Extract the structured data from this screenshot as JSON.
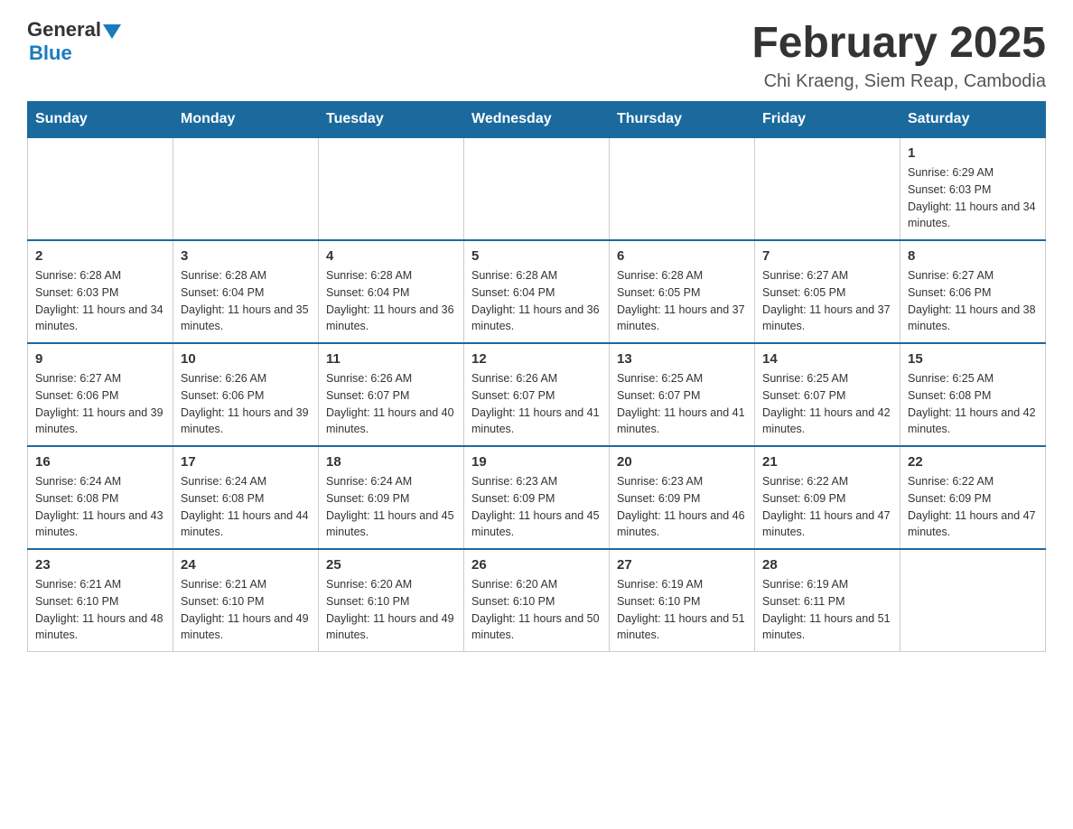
{
  "logo": {
    "general": "General",
    "blue": "Blue"
  },
  "title": "February 2025",
  "subtitle": "Chi Kraeng, Siem Reap, Cambodia",
  "days_of_week": [
    "Sunday",
    "Monday",
    "Tuesday",
    "Wednesday",
    "Thursday",
    "Friday",
    "Saturday"
  ],
  "weeks": [
    [
      {
        "day": "",
        "info": ""
      },
      {
        "day": "",
        "info": ""
      },
      {
        "day": "",
        "info": ""
      },
      {
        "day": "",
        "info": ""
      },
      {
        "day": "",
        "info": ""
      },
      {
        "day": "",
        "info": ""
      },
      {
        "day": "1",
        "info": "Sunrise: 6:29 AM\nSunset: 6:03 PM\nDaylight: 11 hours and 34 minutes."
      }
    ],
    [
      {
        "day": "2",
        "info": "Sunrise: 6:28 AM\nSunset: 6:03 PM\nDaylight: 11 hours and 34 minutes."
      },
      {
        "day": "3",
        "info": "Sunrise: 6:28 AM\nSunset: 6:04 PM\nDaylight: 11 hours and 35 minutes."
      },
      {
        "day": "4",
        "info": "Sunrise: 6:28 AM\nSunset: 6:04 PM\nDaylight: 11 hours and 36 minutes."
      },
      {
        "day": "5",
        "info": "Sunrise: 6:28 AM\nSunset: 6:04 PM\nDaylight: 11 hours and 36 minutes."
      },
      {
        "day": "6",
        "info": "Sunrise: 6:28 AM\nSunset: 6:05 PM\nDaylight: 11 hours and 37 minutes."
      },
      {
        "day": "7",
        "info": "Sunrise: 6:27 AM\nSunset: 6:05 PM\nDaylight: 11 hours and 37 minutes."
      },
      {
        "day": "8",
        "info": "Sunrise: 6:27 AM\nSunset: 6:06 PM\nDaylight: 11 hours and 38 minutes."
      }
    ],
    [
      {
        "day": "9",
        "info": "Sunrise: 6:27 AM\nSunset: 6:06 PM\nDaylight: 11 hours and 39 minutes."
      },
      {
        "day": "10",
        "info": "Sunrise: 6:26 AM\nSunset: 6:06 PM\nDaylight: 11 hours and 39 minutes."
      },
      {
        "day": "11",
        "info": "Sunrise: 6:26 AM\nSunset: 6:07 PM\nDaylight: 11 hours and 40 minutes."
      },
      {
        "day": "12",
        "info": "Sunrise: 6:26 AM\nSunset: 6:07 PM\nDaylight: 11 hours and 41 minutes."
      },
      {
        "day": "13",
        "info": "Sunrise: 6:25 AM\nSunset: 6:07 PM\nDaylight: 11 hours and 41 minutes."
      },
      {
        "day": "14",
        "info": "Sunrise: 6:25 AM\nSunset: 6:07 PM\nDaylight: 11 hours and 42 minutes."
      },
      {
        "day": "15",
        "info": "Sunrise: 6:25 AM\nSunset: 6:08 PM\nDaylight: 11 hours and 42 minutes."
      }
    ],
    [
      {
        "day": "16",
        "info": "Sunrise: 6:24 AM\nSunset: 6:08 PM\nDaylight: 11 hours and 43 minutes."
      },
      {
        "day": "17",
        "info": "Sunrise: 6:24 AM\nSunset: 6:08 PM\nDaylight: 11 hours and 44 minutes."
      },
      {
        "day": "18",
        "info": "Sunrise: 6:24 AM\nSunset: 6:09 PM\nDaylight: 11 hours and 45 minutes."
      },
      {
        "day": "19",
        "info": "Sunrise: 6:23 AM\nSunset: 6:09 PM\nDaylight: 11 hours and 45 minutes."
      },
      {
        "day": "20",
        "info": "Sunrise: 6:23 AM\nSunset: 6:09 PM\nDaylight: 11 hours and 46 minutes."
      },
      {
        "day": "21",
        "info": "Sunrise: 6:22 AM\nSunset: 6:09 PM\nDaylight: 11 hours and 47 minutes."
      },
      {
        "day": "22",
        "info": "Sunrise: 6:22 AM\nSunset: 6:09 PM\nDaylight: 11 hours and 47 minutes."
      }
    ],
    [
      {
        "day": "23",
        "info": "Sunrise: 6:21 AM\nSunset: 6:10 PM\nDaylight: 11 hours and 48 minutes."
      },
      {
        "day": "24",
        "info": "Sunrise: 6:21 AM\nSunset: 6:10 PM\nDaylight: 11 hours and 49 minutes."
      },
      {
        "day": "25",
        "info": "Sunrise: 6:20 AM\nSunset: 6:10 PM\nDaylight: 11 hours and 49 minutes."
      },
      {
        "day": "26",
        "info": "Sunrise: 6:20 AM\nSunset: 6:10 PM\nDaylight: 11 hours and 50 minutes."
      },
      {
        "day": "27",
        "info": "Sunrise: 6:19 AM\nSunset: 6:10 PM\nDaylight: 11 hours and 51 minutes."
      },
      {
        "day": "28",
        "info": "Sunrise: 6:19 AM\nSunset: 6:11 PM\nDaylight: 11 hours and 51 minutes."
      },
      {
        "day": "",
        "info": ""
      }
    ]
  ]
}
